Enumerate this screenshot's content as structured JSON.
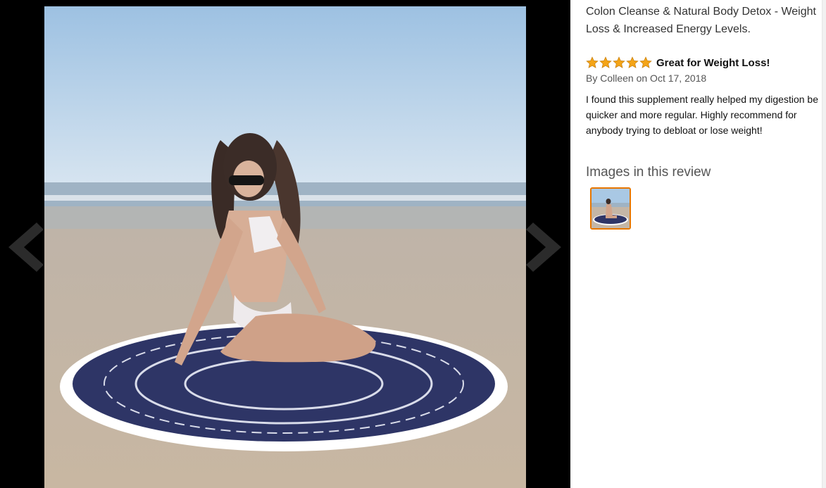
{
  "viewer": {
    "prev_icon": "chevron-left-icon",
    "next_icon": "chevron-right-icon"
  },
  "review": {
    "product_title": "Colon Cleanse & Natural Body Detox - Weight Loss & Increased Energy Levels.",
    "rating": 5,
    "rating_max": 5,
    "star_color": "#f4a417",
    "title": "Great for Weight Loss!",
    "byline": "By Colleen on Oct 17, 2018",
    "body": "I found this supplement really helped my digestion be quicker and more regular. Highly recommend for anybody trying to debloat or lose weight!",
    "images_heading": "Images in this review"
  },
  "colors": {
    "thumb_border": "#e77600",
    "viewer_background": "#000000"
  }
}
